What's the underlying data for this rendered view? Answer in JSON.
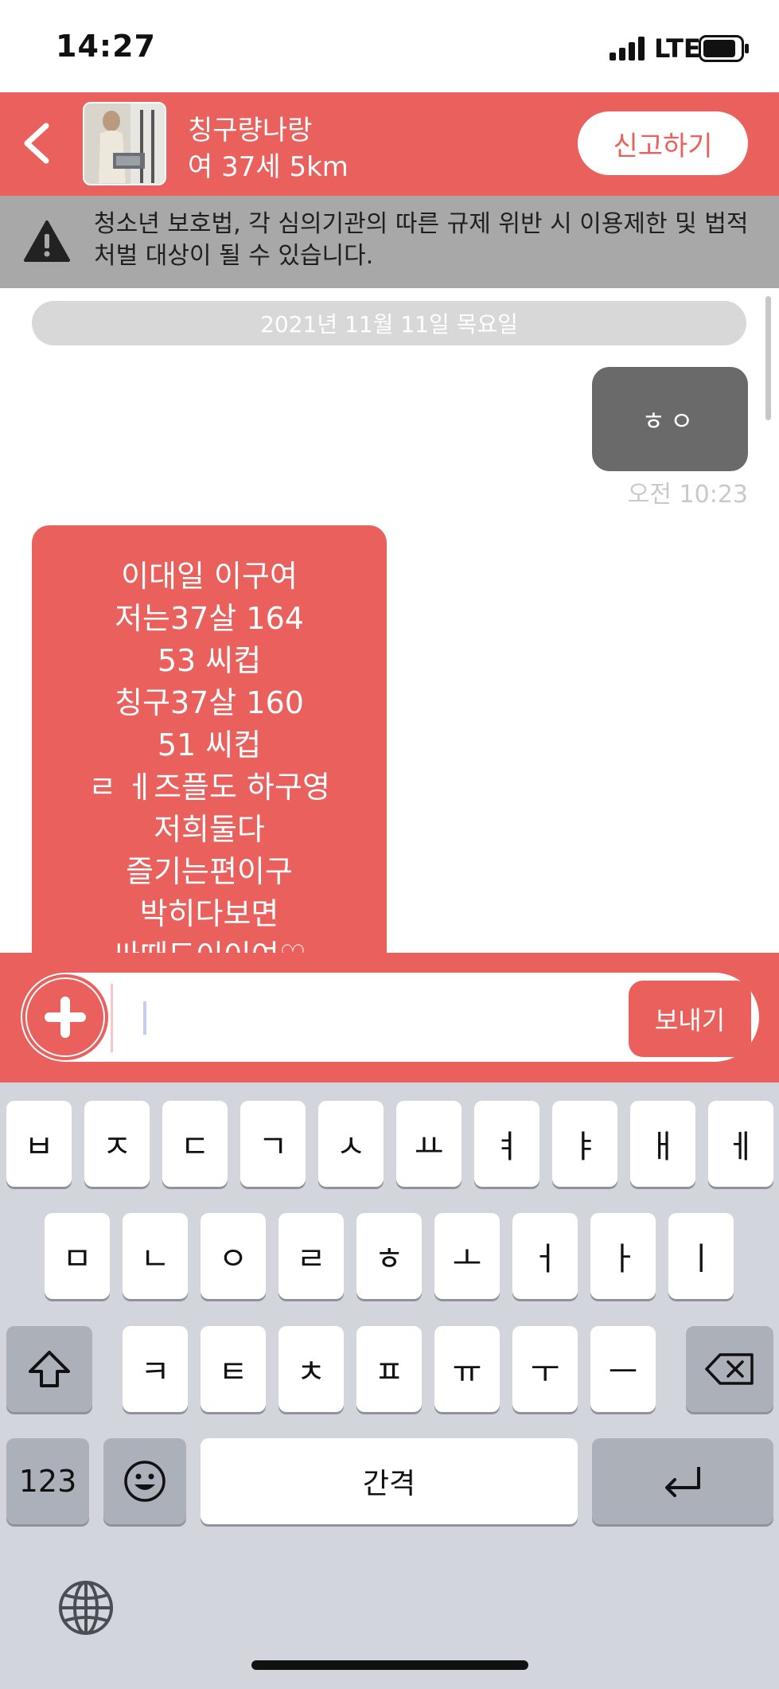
{
  "status_bar": {
    "time": "14:27",
    "network": "LTE",
    "icons": [
      "signal-icon",
      "battery-icon"
    ]
  },
  "header": {
    "back_icon": "chevron-left-icon",
    "user_name": "칭구량나랑",
    "user_meta": "여 37세 5km",
    "report_label": "신고하기",
    "accent_color": "#e9605c"
  },
  "warning": {
    "icon": "warning-triangle-icon",
    "text": "청소년 보호법, 각 심의기관의 따른 규제 위반 시 이용제한 및 법적처벌 대상이 될 수 있습니다."
  },
  "chat": {
    "date_label": "2021년 11월 11일 목요일",
    "messages": [
      {
        "direction": "outgoing",
        "text": "ㅎㅇ",
        "time": "오전 10:23"
      },
      {
        "direction": "incoming",
        "text": "이대일 이구여\n저는37살 164\n53 씨컵\n칭구37살 160\n51 씨컵\nㄹ ㅔ즈플도 하구영\n저희둘다\n즐기는편이구\n박히다보면\n싸때도이이여♡"
      }
    ]
  },
  "input": {
    "plus_icon": "plus-icon",
    "value": "",
    "send_label": "보내기"
  },
  "keyboard": {
    "row1": [
      "ㅂ",
      "ㅈ",
      "ㄷ",
      "ㄱ",
      "ㅅ",
      "ㅛ",
      "ㅕ",
      "ㅑ",
      "ㅐ",
      "ㅔ"
    ],
    "row2": [
      "ㅁ",
      "ㄴ",
      "ㅇ",
      "ㄹ",
      "ㅎ",
      "ㅗ",
      "ㅓ",
      "ㅏ",
      "ㅣ"
    ],
    "row3": [
      "ㅋ",
      "ㅌ",
      "ㅊ",
      "ㅍ",
      "ㅠ",
      "ㅜ",
      "ㅡ"
    ],
    "numbers_label": "123",
    "space_label": "간격",
    "shift_icon": "shift-icon",
    "delete_icon": "backspace-icon",
    "emoji_icon": "emoji-icon",
    "return_icon": "return-icon",
    "globe_icon": "globe-icon"
  }
}
